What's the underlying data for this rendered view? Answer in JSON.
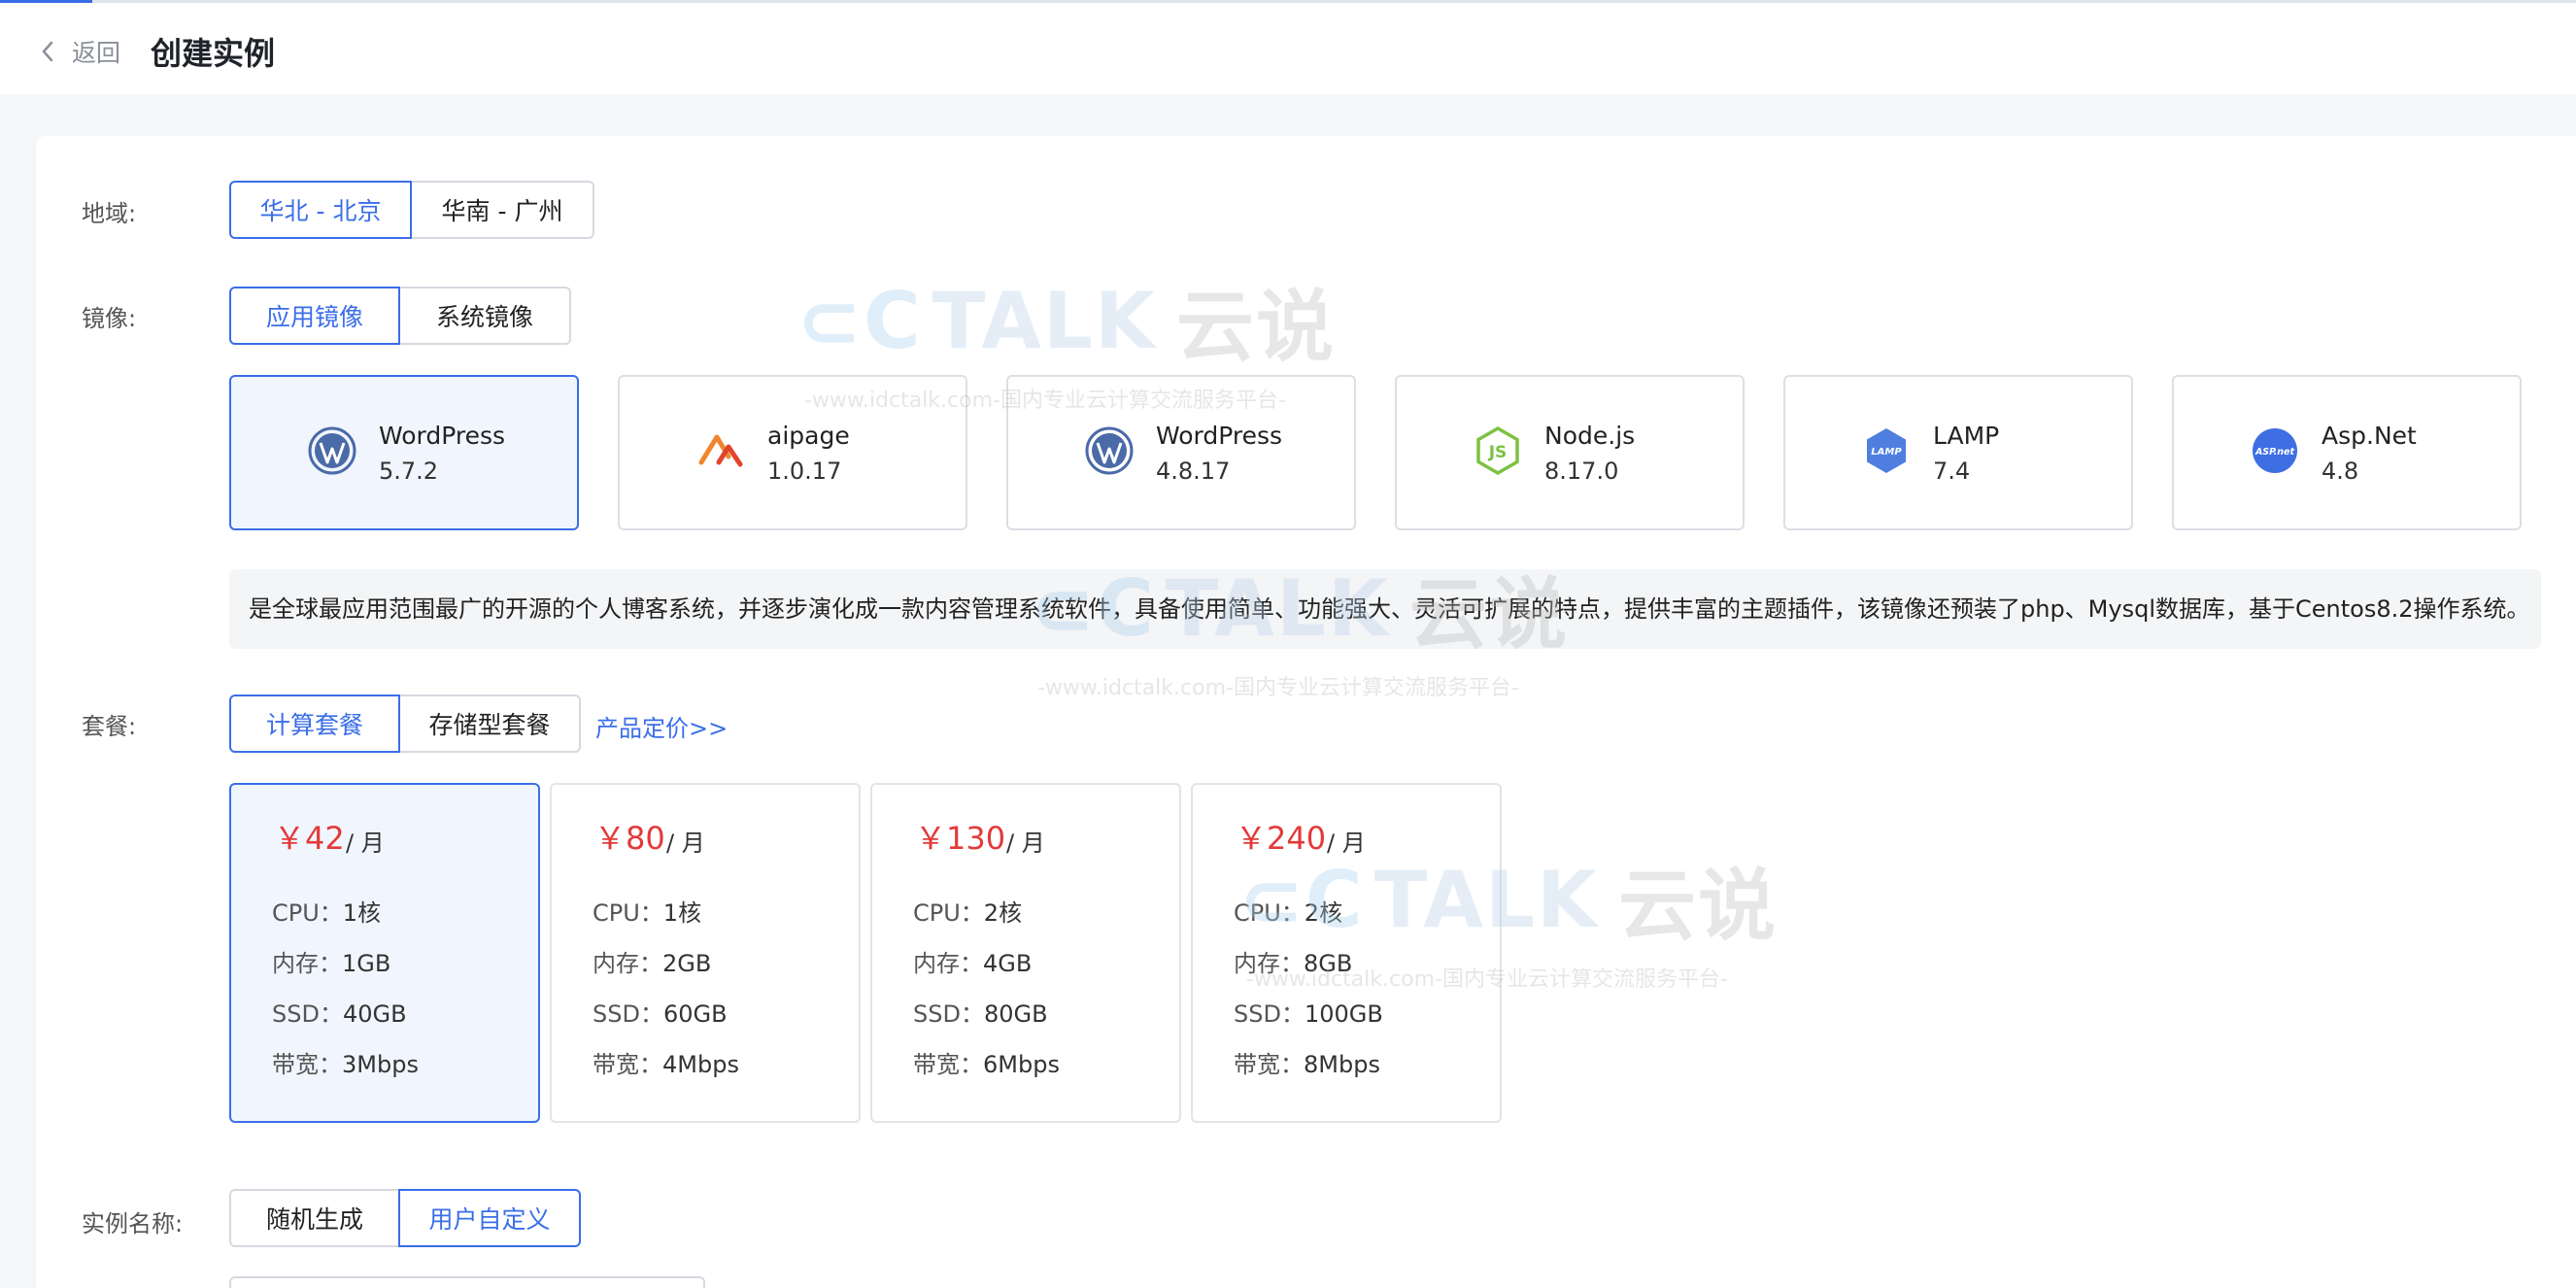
{
  "header": {
    "back_label": "返回",
    "title": "创建实例"
  },
  "region": {
    "label": "地域:",
    "options": [
      "华北 - 北京",
      "华南 - 广州"
    ],
    "selected": "华北 - 北京"
  },
  "image": {
    "label": "镜像:",
    "types": [
      "应用镜像",
      "系统镜像"
    ],
    "selected_type": "应用镜像",
    "items": [
      {
        "name": "WordPress",
        "version": "5.7.2",
        "icon": "wordpress-icon"
      },
      {
        "name": "aipage",
        "version": "1.0.17",
        "icon": "aipage-icon"
      },
      {
        "name": "WordPress",
        "version": "4.8.17",
        "icon": "wordpress-icon"
      },
      {
        "name": "Node.js",
        "version": "8.17.0",
        "icon": "nodejs-icon"
      },
      {
        "name": "LAMP",
        "version": "7.4",
        "icon": "lamp-icon"
      },
      {
        "name": "Asp.Net",
        "version": "4.8",
        "icon": "aspnet-icon"
      }
    ],
    "selected_index": 0,
    "description": "是全球最应用范围最广的开源的个人博客系统，并逐步演化成一款内容管理系统软件，具备使用简单、功能强大、灵活可扩展的特点，提供丰富的主题插件，该镜像还预装了php、Mysql数据库，基于Centos8.2操作系统。"
  },
  "plan": {
    "label": "套餐:",
    "types": [
      "计算套餐",
      "存储型套餐"
    ],
    "selected_type": "计算套餐",
    "pricing_link": "产品定价>>",
    "items": [
      {
        "price": "￥42",
        "unit": "/ 月",
        "cpu_k": "CPU：",
        "cpu": "1核",
        "mem_k": "内存：",
        "mem": "1GB",
        "ssd_k": "SSD：",
        "ssd": "40GB",
        "bw_k": "带宽：",
        "bw": "3Mbps"
      },
      {
        "price": "￥80",
        "unit": "/ 月",
        "cpu_k": "CPU：",
        "cpu": "1核",
        "mem_k": "内存：",
        "mem": "2GB",
        "ssd_k": "SSD：",
        "ssd": "60GB",
        "bw_k": "带宽：",
        "bw": "4Mbps"
      },
      {
        "price": "￥130",
        "unit": "/ 月",
        "cpu_k": "CPU：",
        "cpu": "2核",
        "mem_k": "内存：",
        "mem": "4GB",
        "ssd_k": "SSD：",
        "ssd": "80GB",
        "bw_k": "带宽：",
        "bw": "6Mbps"
      },
      {
        "price": "￥240",
        "unit": "/ 月",
        "cpu_k": "CPU：",
        "cpu": "2核",
        "mem_k": "内存：",
        "mem": "8GB",
        "ssd_k": "SSD：",
        "ssd": "100GB",
        "bw_k": "带宽：",
        "bw": "8Mbps"
      }
    ],
    "selected_index": 0
  },
  "instance_name": {
    "label": "实例名称:",
    "options": [
      "随机生成",
      "用户自定义"
    ],
    "selected": "用户自定义"
  },
  "watermark": {
    "brand_prefix": "TALK",
    "brand_cn": "云说",
    "url_text": "-www.idctalk.com-国内专业云计算交流服务平台-"
  },
  "colors": {
    "accent": "#3a6ee8",
    "price": "#e23a3a",
    "selected_bg": "#f1f6fe"
  }
}
